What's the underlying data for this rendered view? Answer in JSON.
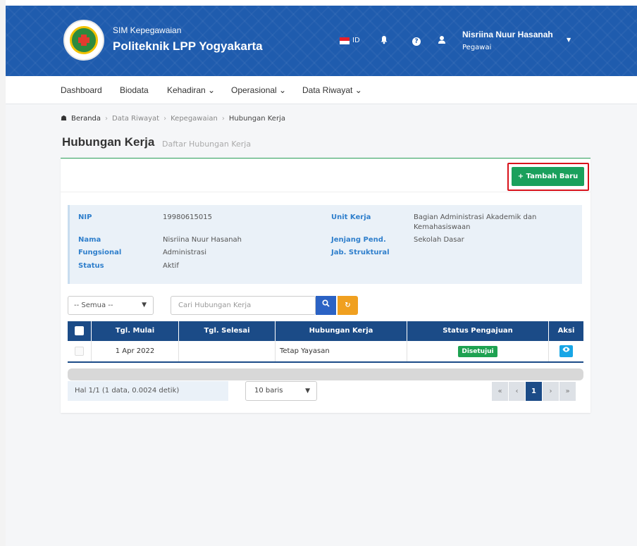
{
  "header": {
    "app_subtitle": "SIM Kepegawaian",
    "app_title": "Politeknik LPP Yogyakarta",
    "lang": "ID",
    "user_name": "Nisriina Nuur Hasanah",
    "user_role": "Pegawai",
    "icons": {
      "bell": "bell-icon",
      "help": "help-icon",
      "user": "user-icon",
      "lang": "flag-icon"
    }
  },
  "nav": {
    "dashboard": "Dashboard",
    "biodata": "Biodata",
    "kehadiran": "Kehadiran ⌄",
    "operasional": "Operasional ⌄",
    "data_riwayat": "Data Riwayat ⌄"
  },
  "breadcrumb": {
    "home": "Beranda",
    "l1": "Data Riwayat",
    "l2": "Kepegawaian",
    "l3": "Hubungan Kerja",
    "separator": "›"
  },
  "page": {
    "title": "Hubungan Kerja",
    "subtitle": "Daftar Hubungan Kerja"
  },
  "actions": {
    "add_label": "+ Tambah Baru"
  },
  "info": {
    "nip_label": "NIP",
    "nip": "19980615015",
    "nama_label": "Nama",
    "nama": "Nisriina Nuur Hasanah",
    "fungsional_label": "Fungsional",
    "fungsional": "Administrasi",
    "status_label": "Status",
    "status": "Aktif",
    "unit_label": "Unit Kerja",
    "unit_line1": "Bagian Administrasi Akademik dan",
    "unit_line2": "Kemahasiswaan",
    "jenjang_label": "Jenjang Pend.",
    "jenjang": "Sekolah Dasar",
    "jab_label": "Jab. Struktural",
    "jab": ""
  },
  "filter": {
    "select_value": "-- Semua --",
    "search_placeholder": "Cari Hubungan Kerja"
  },
  "table": {
    "headers": {
      "mulai": "Tgl. Mulai",
      "selesai": "Tgl. Selesai",
      "hubungan": "Hubungan Kerja",
      "status": "Status Pengajuan",
      "aksi": "Aksi"
    },
    "rows": [
      {
        "mulai": "1 Apr 2022",
        "selesai": "",
        "hubungan": "Tetap Yayasan",
        "status": "Disetujui"
      }
    ]
  },
  "footer": {
    "page_info": "Hal 1/1 (1 data, 0.0024 detik)",
    "rows_value": "10 baris",
    "pager": {
      "first": "«",
      "prev": "‹",
      "current": "1",
      "next": "›",
      "last": "»"
    }
  },
  "colors": {
    "header_blue": "#1f5cae",
    "table_head": "#1b4b87",
    "add_green": "#1aa05c",
    "highlight_red": "#d8121b",
    "badge_green": "#1ea251",
    "eye_blue": "#17a6e6",
    "reset_orange": "#f0a020"
  }
}
